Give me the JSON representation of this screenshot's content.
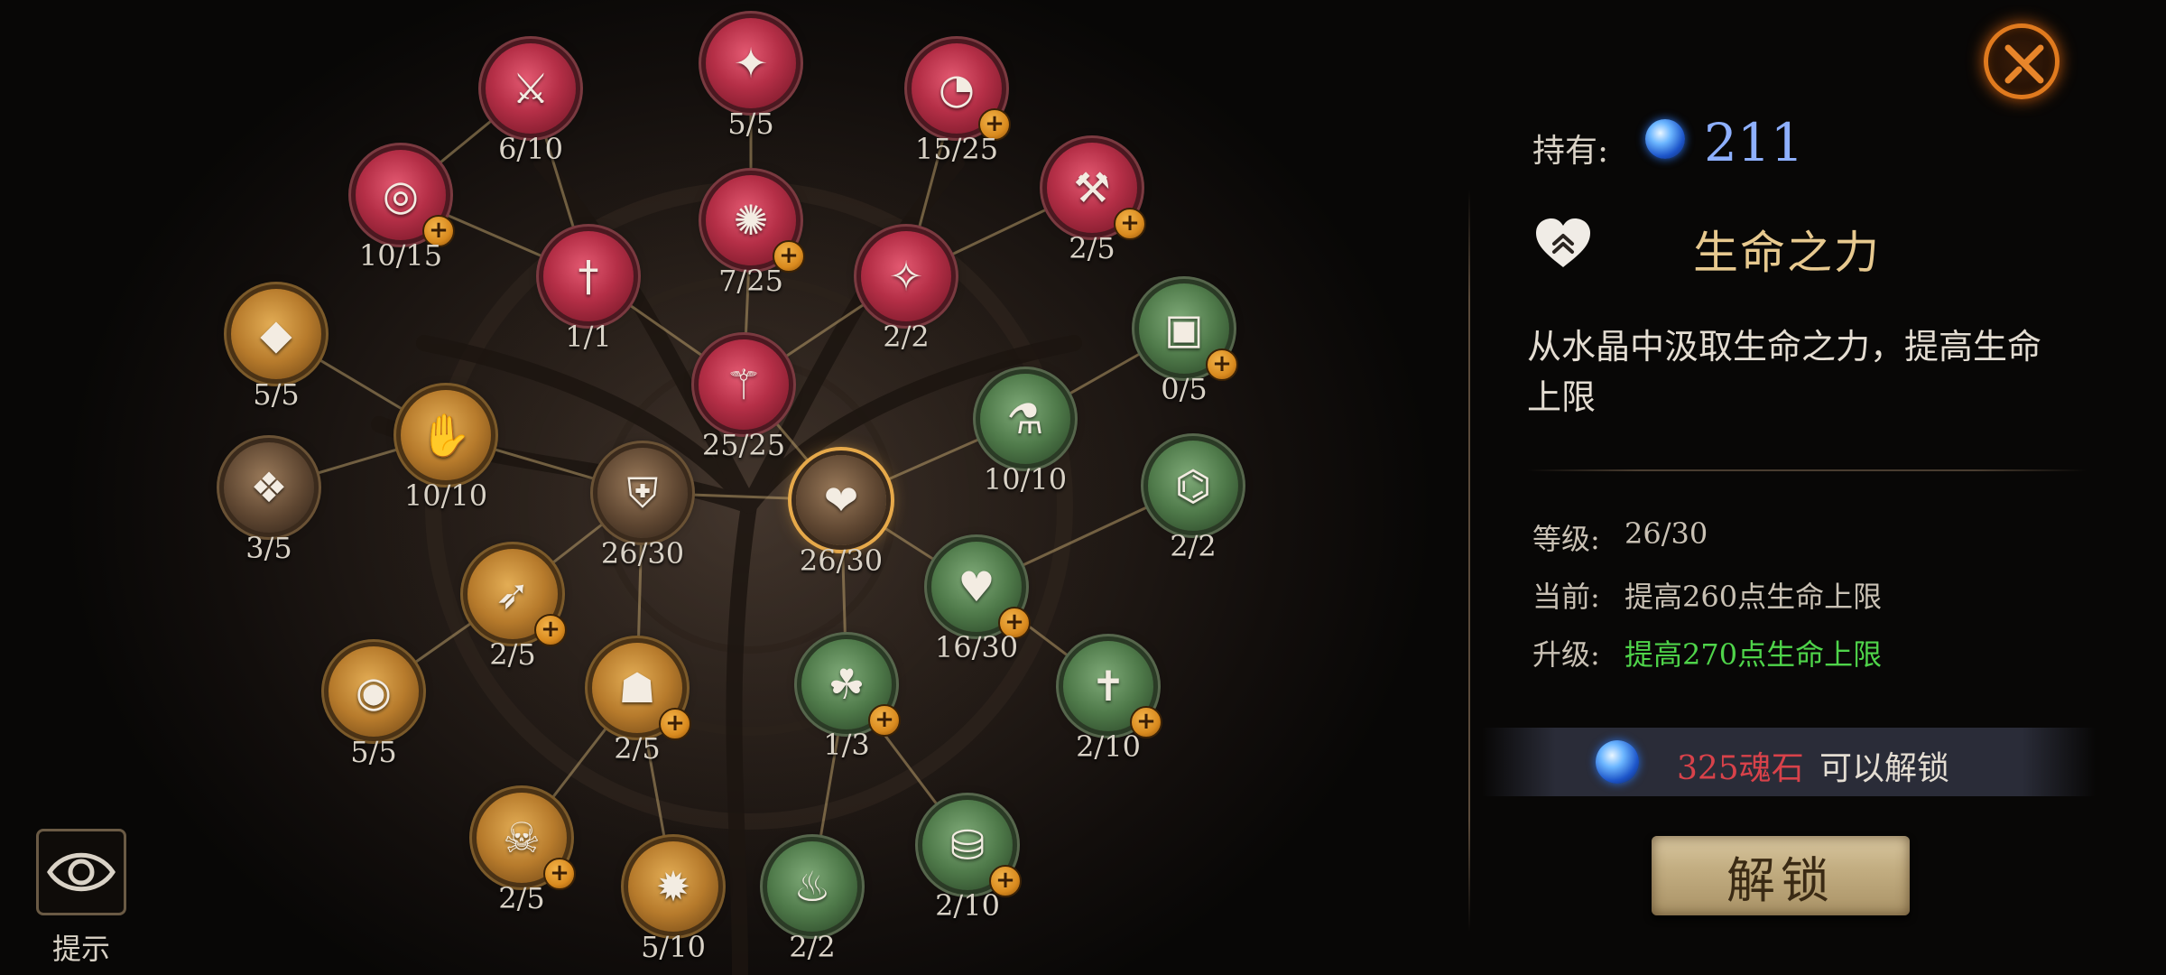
{
  "header": {
    "close_icon": "crossed-swords-close-icon"
  },
  "hint": {
    "icon": "eye-icon",
    "label": "提示"
  },
  "currency": {
    "hold_label": "持有:",
    "icon": "soul-stone-orb-icon",
    "amount": "211"
  },
  "selected_skill": {
    "icon": "heart-upgrade-icon",
    "name": "生命之力",
    "description": "从水晶中汲取生命之力，提高生命上限",
    "level_label": "等级:",
    "level_value": "26/30",
    "current_label": "当前:",
    "current_value": "提高260点生命上限",
    "upgrade_label": "升级:",
    "upgrade_value": "提高270点生命上限"
  },
  "unlock": {
    "cost": "325魂石",
    "suffix": "可以解锁",
    "button_label": "解锁"
  },
  "colors": {
    "red_branch": "#b52f47",
    "gold_branch": "#b77b2c",
    "green_branch": "#4f7a4a",
    "upgrade_text": "#4fd44a",
    "cost_text": "#d8424a",
    "currency_text": "#8eb0ff",
    "accent_orange": "#e07a1e"
  },
  "skill_nodes": [
    {
      "id": "blade-top",
      "branch": "red",
      "icon": "sword-icon",
      "level": "6/10",
      "upgradeable": false
    },
    {
      "id": "shuriken-top",
      "branch": "red",
      "icon": "shuriken-icon",
      "level": "5/5",
      "upgradeable": false
    },
    {
      "id": "clock-top",
      "branch": "red",
      "icon": "timer-icon",
      "level": "15/25",
      "upgradeable": true
    },
    {
      "id": "target-left",
      "branch": "red",
      "icon": "crosshair-icon",
      "level": "10/15",
      "upgradeable": true
    },
    {
      "id": "swirl-mid",
      "branch": "red",
      "icon": "whirlwind-icon",
      "level": "7/25",
      "upgradeable": true
    },
    {
      "id": "bone-right",
      "branch": "red",
      "icon": "club-icon",
      "level": "2/5",
      "upgradeable": true
    },
    {
      "id": "daggers",
      "branch": "red",
      "icon": "dual-dagger-icon",
      "level": "1/1",
      "upgradeable": false
    },
    {
      "id": "star-info",
      "branch": "red",
      "icon": "star-plus-icon",
      "level": "2/2",
      "upgradeable": false
    },
    {
      "id": "sword-up",
      "branch": "red",
      "icon": "sword-upgrade-icon",
      "level": "25/25",
      "upgradeable": false
    },
    {
      "id": "crystal-a",
      "branch": "gold",
      "icon": "crystal-icon",
      "level": "5/5",
      "upgradeable": false
    },
    {
      "id": "crystal-hand",
      "branch": "gold",
      "icon": "crystal-hand-icon",
      "level": "10/10",
      "upgradeable": false
    },
    {
      "id": "crystal-b",
      "branch": "brown",
      "icon": "crystal-shard-icon",
      "level": "3/5",
      "upgradeable": false
    },
    {
      "id": "shield-up",
      "branch": "brown",
      "icon": "shield-upgrade-icon",
      "level": "26/30",
      "upgradeable": false
    },
    {
      "id": "dash",
      "branch": "gold",
      "icon": "sprint-icon",
      "level": "2/5",
      "upgradeable": true
    },
    {
      "id": "eye-swirl",
      "branch": "gold",
      "icon": "vortex-eye-icon",
      "level": "5/5",
      "upgradeable": false
    },
    {
      "id": "cloak",
      "branch": "gold",
      "icon": "cloak-icon",
      "level": "2/5",
      "upgradeable": true
    },
    {
      "id": "beast",
      "branch": "gold",
      "icon": "beast-mask-icon",
      "level": "2/5",
      "upgradeable": true
    },
    {
      "id": "burst",
      "branch": "gold",
      "icon": "explosion-icon",
      "level": "5/10",
      "upgradeable": false
    },
    {
      "id": "heart-up",
      "branch": "brown",
      "icon": "heart-upgrade-icon",
      "level": "26/30",
      "upgradeable": false,
      "selected": true
    },
    {
      "id": "potion-shield",
      "branch": "green",
      "icon": "potion-icon",
      "level": "10/10",
      "upgradeable": false
    },
    {
      "id": "chest",
      "branch": "green",
      "icon": "treasure-chest-icon",
      "level": "0/5",
      "upgradeable": true
    },
    {
      "id": "heart-hands",
      "branch": "green",
      "icon": "heart-hands-icon",
      "level": "16/30",
      "upgradeable": true
    },
    {
      "id": "scroll-chest",
      "branch": "green",
      "icon": "scroll-chest-icon",
      "level": "2/2",
      "upgradeable": false
    },
    {
      "id": "drumstick",
      "branch": "green",
      "icon": "meat-icon",
      "level": "1/3",
      "upgradeable": true
    },
    {
      "id": "cross-sword",
      "branch": "green",
      "icon": "holy-sword-icon",
      "level": "2/10",
      "upgradeable": true
    },
    {
      "id": "coin-bag",
      "branch": "green",
      "icon": "money-bag-icon",
      "level": "2/10",
      "upgradeable": true
    },
    {
      "id": "hearth",
      "branch": "green",
      "icon": "campfire-icon",
      "level": "2/2",
      "upgradeable": false
    }
  ]
}
